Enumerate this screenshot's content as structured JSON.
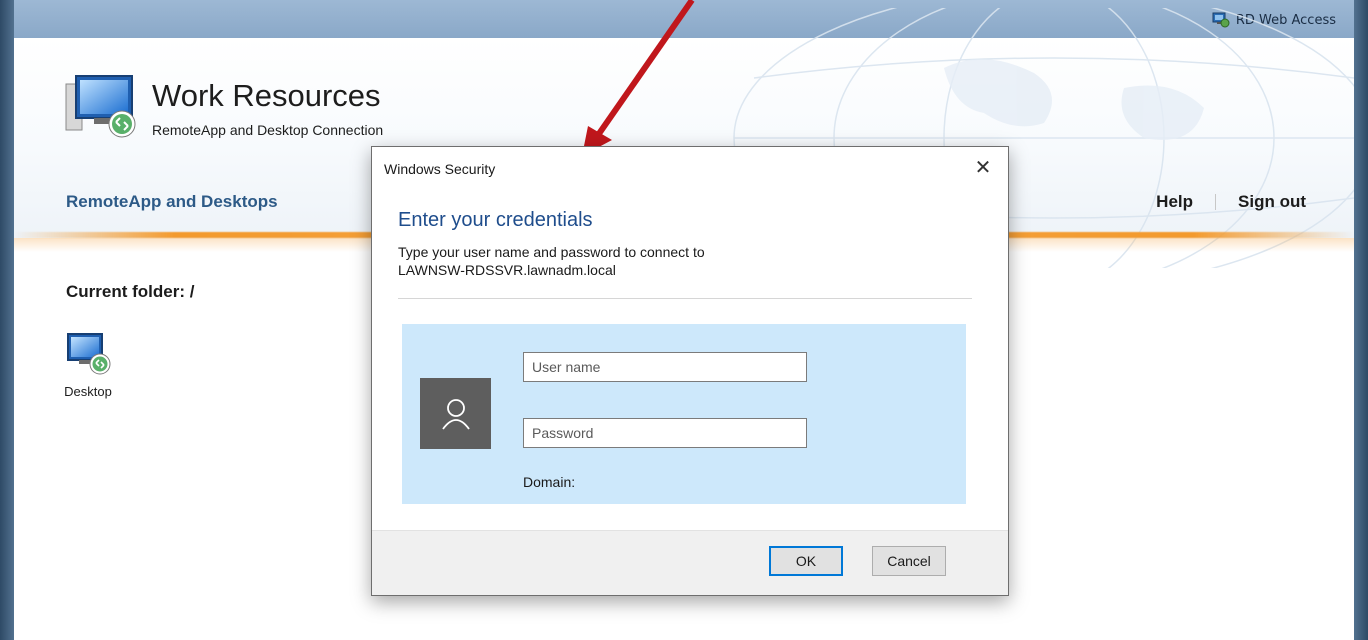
{
  "header": {
    "rd_web_access": "RD Web Access",
    "title": "Work Resources",
    "subtitle": "RemoteApp and Desktop Connection"
  },
  "nav": {
    "remoteapp": "RemoteApp and Desktops",
    "help": "Help",
    "sign_out": "Sign out"
  },
  "content": {
    "current_folder": "Current folder: /",
    "items": [
      {
        "label": "Desktop",
        "icon": "remote-desktop-icon"
      }
    ]
  },
  "dialog": {
    "title": "Windows Security",
    "heading": "Enter your credentials",
    "description_line1": "Type your user name and password to connect to",
    "description_line2": "LAWNSW-RDSSVR.lawnadm.local",
    "username_placeholder": "User name",
    "password_placeholder": "Password",
    "domain_label": "Domain:",
    "ok_label": "OK",
    "cancel_label": "Cancel",
    "close_symbol": "✕"
  },
  "colors": {
    "accent_blue": "#1f4d8c",
    "nav_blue": "#2d5a87",
    "orange": "#f39a2d",
    "panel_blue": "#cde8fb",
    "arrow_red": "#c0171c"
  }
}
